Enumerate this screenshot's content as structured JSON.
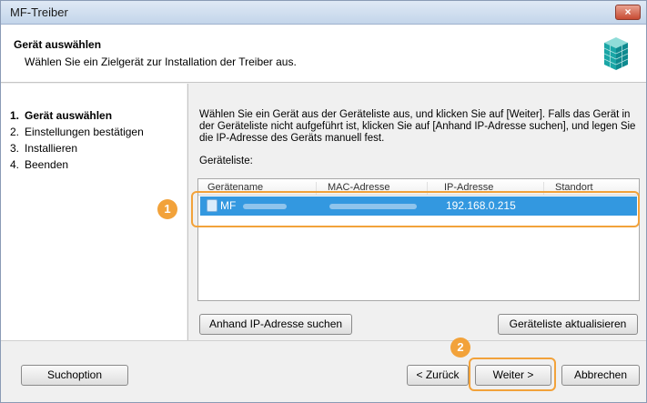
{
  "window": {
    "title": "MF-Treiber",
    "close_symbol": "×"
  },
  "header": {
    "title": "Gerät auswählen",
    "subtitle": "Wählen Sie ein Zielgerät zur Installation der Treiber aus.",
    "logo_icon": "cube-stack-icon"
  },
  "steps": [
    {
      "num": "1.",
      "label": "Gerät auswählen",
      "active": true
    },
    {
      "num": "2.",
      "label": "Einstellungen bestätigen",
      "active": false
    },
    {
      "num": "3.",
      "label": "Installieren",
      "active": false
    },
    {
      "num": "4.",
      "label": "Beenden",
      "active": false
    }
  ],
  "content": {
    "instructions": "Wählen Sie ein Gerät aus der Geräteliste aus, und klicken Sie auf [Weiter]. Falls das Gerät in der Geräteliste nicht aufgeführt ist, klicken Sie auf [Anhand IP-Adresse suchen], und legen Sie die IP-Adresse des Geräts manuell fest.",
    "list_label": "Geräteliste:",
    "columns": [
      "Gerätename",
      "MAC-Adresse",
      "IP-Adresse",
      "Standort"
    ],
    "devices": [
      {
        "name": "MF",
        "mac": "",
        "ip": "192.168.0.215",
        "location": ""
      }
    ],
    "search_ip_button": "Anhand IP-Adresse suchen",
    "refresh_button": "Geräteliste aktualisieren"
  },
  "footer": {
    "search_option_button": "Suchoption",
    "back_button": "< Zurück",
    "next_button": "Weiter >",
    "cancel_button": "Abbrechen"
  },
  "callouts": {
    "one": "1",
    "two": "2"
  },
  "colors": {
    "selection": "#3398e0",
    "callout": "#f2a23a"
  }
}
